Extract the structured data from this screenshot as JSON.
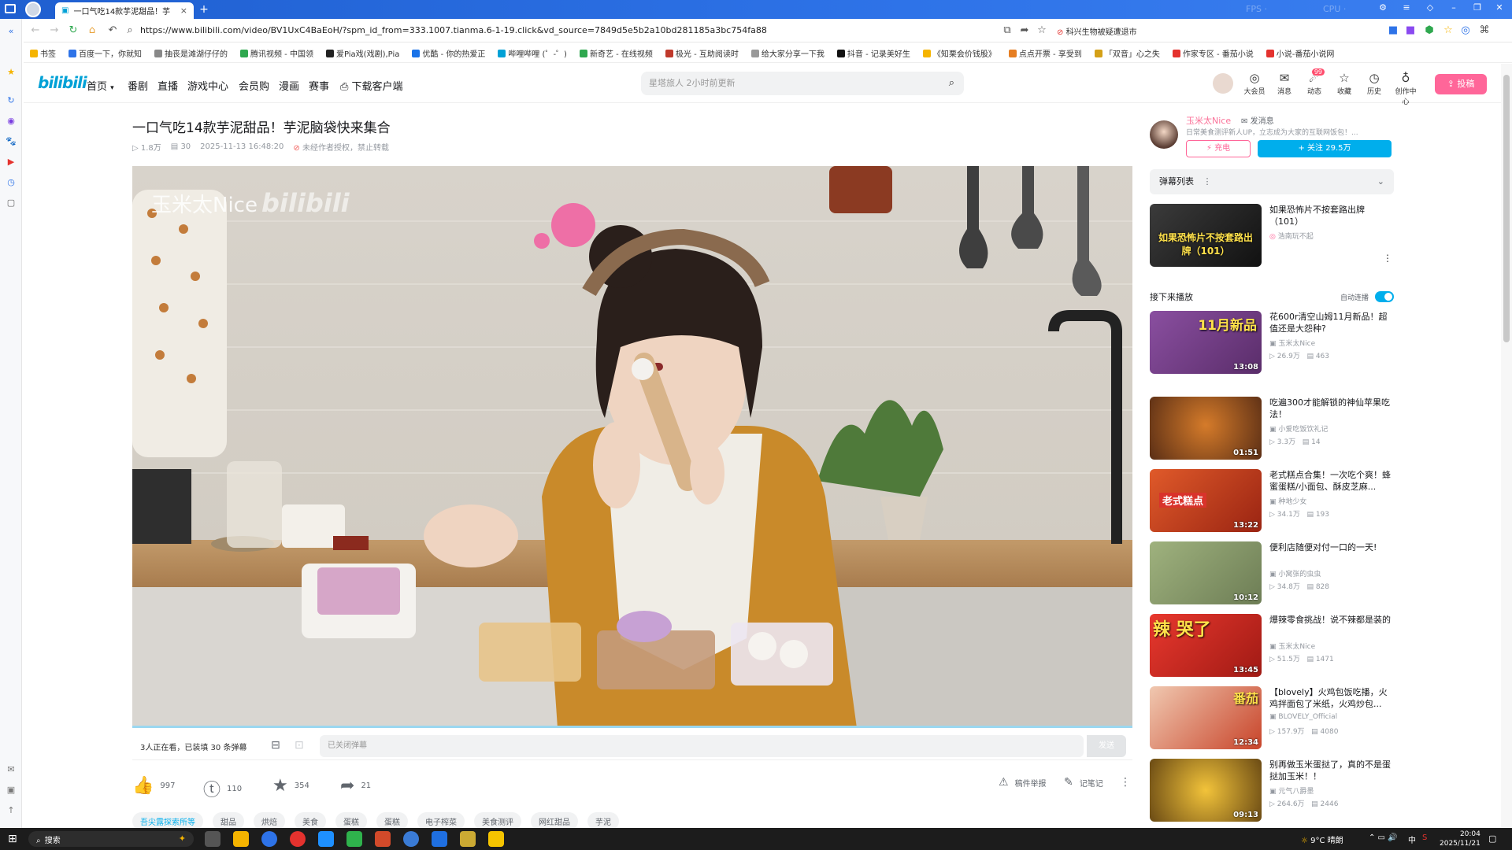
{
  "browser": {
    "tab_title": "一口气吃14款芋泥甜品！芋",
    "url": "https://www.bilibili.com/video/BV1UxC4BaEoH/?spm_id_from=333.1007.tianma.6-1-19.click&vd_source=7849d5e5b2a10bd281185a3bc754fa88",
    "search_suggest": "科兴生物被疑遭退市",
    "bookmarks": [
      "书签",
      "百度一下，你就知",
      "抽丧是滩湖仔仔的",
      "腾讯视频 - 中国领",
      "爱Pia戏(戏剧),Pia",
      "优酷 - 你的热爱正",
      "哔哩哔哩 (゜-゜)",
      "新奇艺 - 在线视频",
      "极光 - 互助阅读时",
      "给大家分享一下我",
      "抖音 - 记录美好生",
      "《知栗会价钱股》",
      "点点开票 - 享受到",
      "「双音」心之失",
      "作家专区 - 番茄小说",
      "小说-番茄小说网"
    ]
  },
  "site": {
    "logo": "bilibili",
    "nav": [
      "首页",
      "番剧",
      "直播",
      "游戏中心",
      "会员购",
      "漫画",
      "赛事",
      "下载客户端"
    ],
    "search_placeholder": "星塔旅人 2小时前更新",
    "header_icons": [
      {
        "label": "大会员"
      },
      {
        "label": "消息"
      },
      {
        "label": "动态",
        "badge": "99"
      },
      {
        "label": "收藏"
      },
      {
        "label": "历史"
      },
      {
        "label": "创作中心"
      }
    ],
    "upload": "投稿"
  },
  "video": {
    "title": "一口气吃14款芋泥甜品！芋泥脑袋快来集合",
    "views": "1.8万",
    "danmaku_count": "30",
    "datetime": "2025-11-13 16:48:20",
    "copyright": "未经作者授权，禁止转载",
    "watermark_name": "玉米太Nice",
    "watermark_logo": "bilibili",
    "watching": "3人正在看，已装填 30 条弹幕",
    "danmaku_placeholder": "已关闭弹幕",
    "send": "发送",
    "likes": "997",
    "coins": "110",
    "favorites": "354",
    "shares": "21",
    "report": "稿件举报",
    "notes": "记笔记",
    "tags": [
      "吾尖露探索所等",
      "甜品",
      "烘焙",
      "美食",
      "蛋糕",
      "蛋糕",
      "电子榨菜",
      "美食测评",
      "网红甜品",
      "芋泥"
    ]
  },
  "uploader": {
    "name": "玉米太Nice",
    "message": "发消息",
    "desc": "日常美食测评新人UP，立志成为大家的互联网饭包！...",
    "charge": "充电",
    "follow": "关注 29.5万"
  },
  "sidebar": {
    "danmaku_list": "弹幕列表",
    "ad": {
      "title": "如果恐怖片不按套路出牌（101）",
      "uploader": "浩南玩不起",
      "thumb_text": "如果恐怖片不按套路出牌（101）"
    },
    "next_label": "接下来播放",
    "autoplay_label": "自动连播",
    "recommendations": [
      {
        "title": "花600r清空山姆11月新品！超值还是大怨种?",
        "uploader": "玉米太Nice",
        "views": "26.9万",
        "danmaku": "463",
        "duration": "13:08",
        "thumb_text": "11月新品",
        "bg": "#7b4a8f"
      },
      {
        "title": "吃遍300才能解锁的神仙苹果吃法！",
        "uploader": "小爱吃饭饮礼记",
        "views": "3.3万",
        "danmaku": "14",
        "duration": "01:51",
        "thumb_text": "",
        "bg": "#a0522d"
      },
      {
        "title": "老式糕点合集！一次吃个爽！蜂蜜蛋糕/小面包、酥皮芝麻...",
        "uploader": "种地少女",
        "views": "34.1万",
        "danmaku": "193",
        "duration": "13:22",
        "thumb_text": "老式糕点",
        "bg": "#c8442a"
      },
      {
        "title": "便利店随便对付一口的一天!",
        "uploader": "小窝张的虫虫",
        "views": "34.8万",
        "danmaku": "828",
        "duration": "10:12",
        "thumb_text": "",
        "bg": "#8a9a6a"
      },
      {
        "title": "爆辣零食挑战！说不辣都是装的",
        "uploader": "玉米太Nice",
        "views": "51.5万",
        "danmaku": "1471",
        "duration": "13:45",
        "thumb_text": "辣 哭了",
        "bg": "#d9332b"
      },
      {
        "title": "【blovely】火鸡包饭吃播，火鸡拌面包了米纸，火鸡炒包...",
        "uploader": "BLOVELY_Official",
        "views": "157.9万",
        "danmaku": "4080",
        "duration": "12:34",
        "thumb_text": "番茄",
        "bg": "#e05a3a"
      },
      {
        "title": "别再做玉米蛋挞了，真的不是蛋挞加玉米！！",
        "uploader": "元气八爵墨",
        "views": "264.6万",
        "danmaku": "2446",
        "duration": "09:13",
        "thumb_text": "",
        "bg": "#d6a01e"
      }
    ]
  },
  "taskbar": {
    "search": "搜索",
    "weather": "9°C 晴朗",
    "ime": "中",
    "time": "20:04",
    "date": "2025/11/21"
  }
}
